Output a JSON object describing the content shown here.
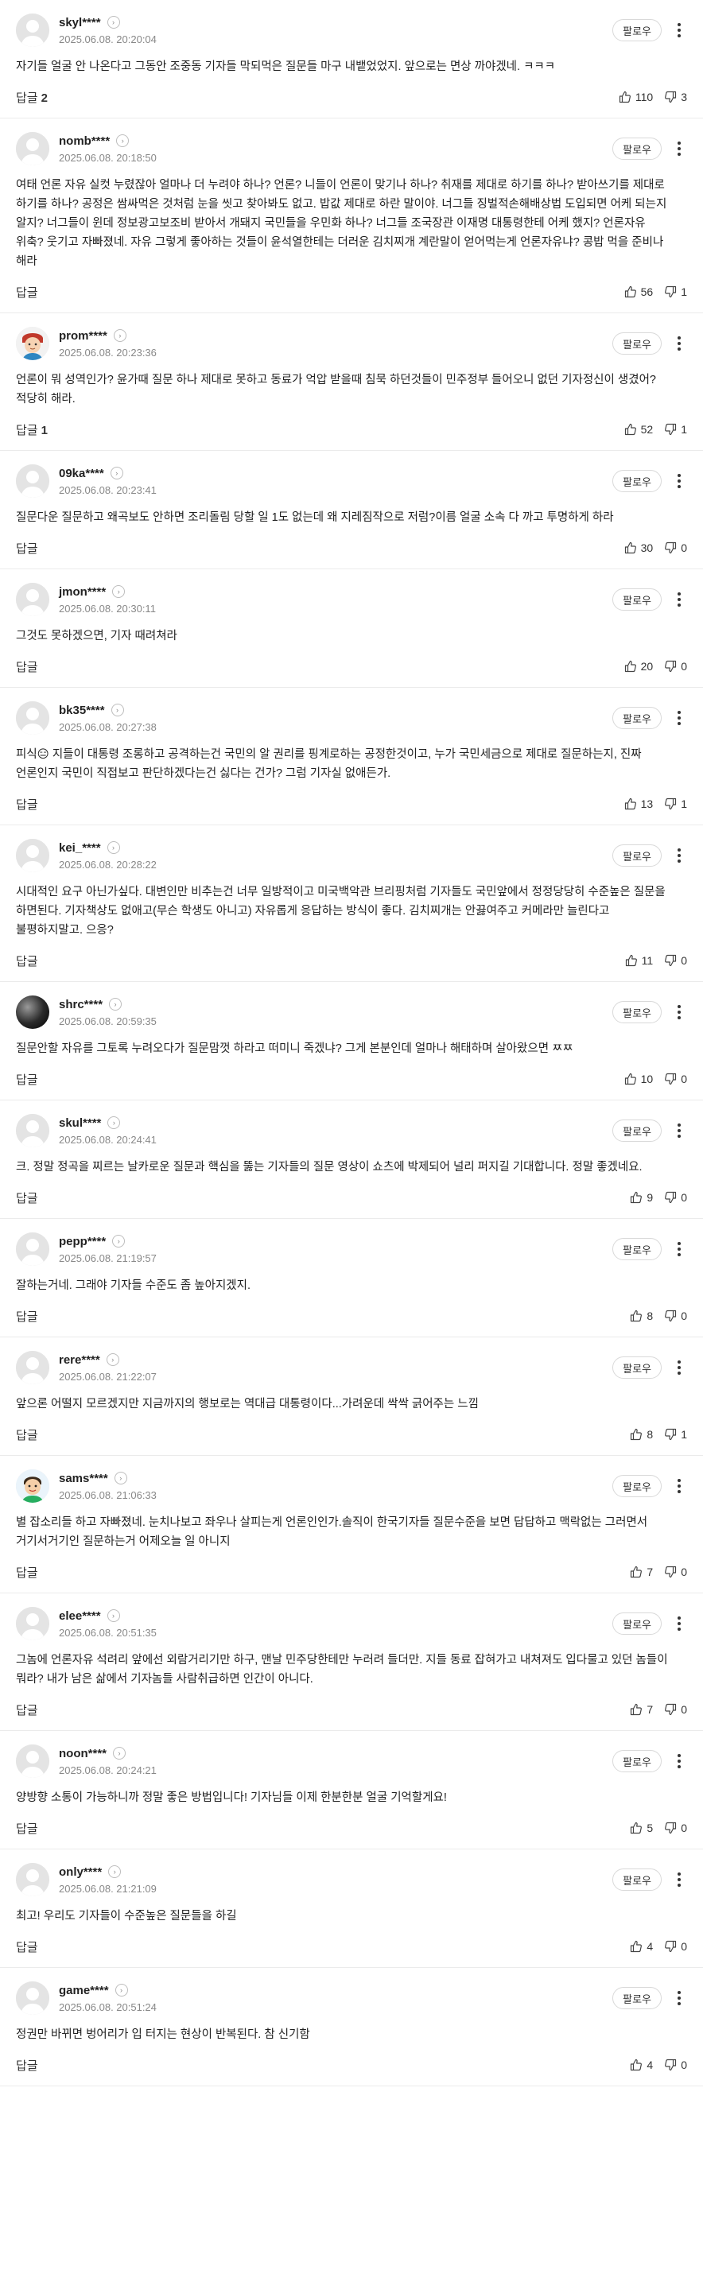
{
  "ui": {
    "reply_label": "답글",
    "follow_label": "팔로우"
  },
  "comments": [
    {
      "nick": "skyl****",
      "date": "2025.06.08. 20:20:04",
      "text": "자기들 얼굴 안 나온다고 그동안 조중동 기자들 막되먹은 질문들 마구 내뱉었었지. 앞으로는 면상 까야겠네. ㅋㅋㅋ",
      "replies": "2",
      "likes": "110",
      "dislikes": "3",
      "avatar": "default"
    },
    {
      "nick": "nomb****",
      "date": "2025.06.08. 20:18:50",
      "text": "여태 언론 자유 실컷 누렸잖아 얼마나 더 누려야 하나? 언론? 니들이 언론이 맞기나 하나? 취재를 제대로 하기를 하나? 받아쓰기를 제대로 하기를 하나? 공정은 쌈싸먹은 것처럼 눈을 씻고 찾아봐도 없고. 밥값 제대로 하란 말이야. 너그들 징벌적손해배상법 도입되면 어케 되는지 알지? 너그들이 윈데 정보광고보조비 받아서 개돼지 국민들을 우민화 하나? 너그들 조국장관 이재명 대통령한테 어케 했지? 언론자유 위축? 웃기고 자빠졌네. 자유 그렇게 좋아하는 것들이 윤석열한테는 더러운 김치찌개 계란말이 얻어먹는게 언론자유냐? 콩밥 먹을 준비나 해라",
      "replies": "",
      "likes": "56",
      "dislikes": "1",
      "avatar": "default"
    },
    {
      "nick": "prom****",
      "date": "2025.06.08. 20:23:36",
      "text": "언론이 뭐 성역인가? 윤가때 질문 하나 제대로 못하고 동료가 억압 받을때 침묵 하던것들이 민주정부 들어오니 없던 기자정신이 생겼어? 적당히 해라.",
      "replies": "1",
      "likes": "52",
      "dislikes": "1",
      "avatar": "cartoon"
    },
    {
      "nick": "09ka****",
      "date": "2025.06.08. 20:23:41",
      "text": "질문다운 질문하고 왜곡보도 안하면 조리돌림 당할 일 1도 없는데 왜 지레짐작으로 저럼?이름 얼굴 소속 다 까고 투명하게 하라",
      "replies": "",
      "likes": "30",
      "dislikes": "0",
      "avatar": "default"
    },
    {
      "nick": "jmon****",
      "date": "2025.06.08. 20:30:11",
      "text": "그것도 못하겠으면, 기자 때려쳐라",
      "replies": "",
      "likes": "20",
      "dislikes": "0",
      "avatar": "default"
    },
    {
      "nick": "bk35****",
      "date": "2025.06.08. 20:27:38",
      "text": "피식😑 지들이 대통령 조롱하고 공격하는건 국민의 알 권리를 핑계로하는 공정한것이고, 누가 국민세금으로 제대로 질문하는지, 진짜 언론인지 국민이 직접보고 판단하겠다는건 싫다는 건가? 그럼 기자실 없애든가.",
      "replies": "",
      "likes": "13",
      "dislikes": "1",
      "avatar": "default"
    },
    {
      "nick": "kei_****",
      "date": "2025.06.08. 20:28:22",
      "text": "시대적인 요구 아닌가싶다. 대변인만 비추는건 너무 일방적이고 미국백악관 브리핑처럼 기자들도 국민앞에서 정정당당히 수준높은 질문을 하면된다. 기자책상도 없애고(무슨 학생도 아니고) 자유롭게 응답하는 방식이 좋다. 김치찌개는 안끓여주고 커메라만 늘린다고 불평하지말고. 으응?",
      "replies": "",
      "likes": "11",
      "dislikes": "0",
      "avatar": "default"
    },
    {
      "nick": "shrc****",
      "date": "2025.06.08. 20:59:35",
      "text": "질문안할 자유를 그토록 누려오다가 질문맘껏 하라고 떠미니 죽겠냐? 그게 본분인데 얼마나 해태하며 살아왔으면 ㅉㅉ",
      "replies": "",
      "likes": "10",
      "dislikes": "0",
      "avatar": "dark"
    },
    {
      "nick": "skul****",
      "date": "2025.06.08. 20:24:41",
      "text": "크. 정말 정곡을 찌르는 날카로운 질문과 핵심을 뚫는 기자들의 질문 영상이 쇼츠에 박제되어 널리 퍼지길 기대합니다. 정말 좋겠네요.",
      "replies": "",
      "likes": "9",
      "dislikes": "0",
      "avatar": "default"
    },
    {
      "nick": "pepp****",
      "date": "2025.06.08. 21:19:57",
      "text": "잘하는거네. 그래야 기자들 수준도 좀 높아지겠지.",
      "replies": "",
      "likes": "8",
      "dislikes": "0",
      "avatar": "default"
    },
    {
      "nick": "rere****",
      "date": "2025.06.08. 21:22:07",
      "text": "앞으론 어떨지 모르겠지만 지금까지의 행보로는 역대급 대통령이다...가려운데 싹싹 긁어주는 느낌",
      "replies": "",
      "likes": "8",
      "dislikes": "1",
      "avatar": "default"
    },
    {
      "nick": "sams****",
      "date": "2025.06.08. 21:06:33",
      "text": "별 잡소리들 하고 자빠졌네. 눈치나보고 좌우나 살피는게 언론인인가.솔직이 한국기자들 질문수준을 보면 답답하고 맥락없는 그러면서 거기서거기인 질문하는거 어제오늘 일 아니지",
      "replies": "",
      "likes": "7",
      "dislikes": "0",
      "avatar": "cartoon2"
    },
    {
      "nick": "elee****",
      "date": "2025.06.08. 20:51:35",
      "text": "그놈에 언론자유 석려리 앞에선 외람거리기만 하구, 맨날 민주당한테만 누러려 들더만. 지들 동료 잡혀가고 내쳐져도 입다물고 있던 놈들이 뭐라? 내가 남은 삶에서 기자놈들 사람취급하면 인간이 아니다.",
      "replies": "",
      "likes": "7",
      "dislikes": "0",
      "avatar": "default"
    },
    {
      "nick": "noon****",
      "date": "2025.06.08. 20:24:21",
      "text": "양방향 소통이 가능하니까 정말 좋은 방법입니다! 기자님들 이제 한분한분 얼굴 기억할게요!",
      "replies": "",
      "likes": "5",
      "dislikes": "0",
      "avatar": "default"
    },
    {
      "nick": "only****",
      "date": "2025.06.08. 21:21:09",
      "text": "최고! 우리도 기자들이 수준높은 질문들을 하길",
      "replies": "",
      "likes": "4",
      "dislikes": "0",
      "avatar": "default"
    },
    {
      "nick": "game****",
      "date": "2025.06.08. 20:51:24",
      "text": "정권만 바뀌면 벙어리가 입 터지는 현상이 반복된다. 참 신기함",
      "replies": "",
      "likes": "4",
      "dislikes": "0",
      "avatar": "default"
    }
  ]
}
